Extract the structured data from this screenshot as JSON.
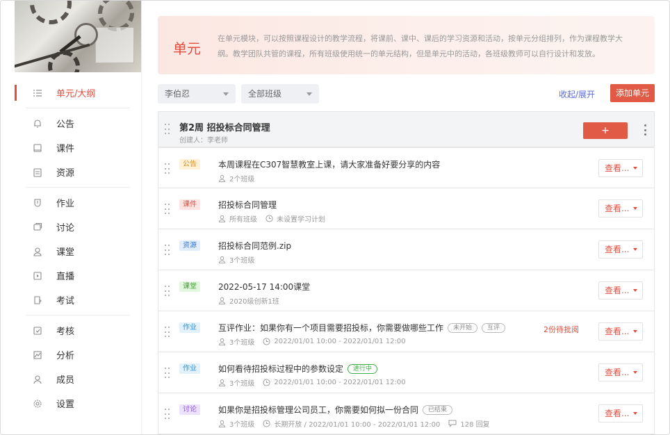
{
  "sidebar": {
    "items": [
      {
        "label": "单元/大纲",
        "icon": "list-icon",
        "active": true
      },
      {
        "label": "公告",
        "icon": "bell-icon"
      },
      {
        "label": "课件",
        "icon": "book-icon"
      },
      {
        "label": "资源",
        "icon": "folder-icon"
      },
      {
        "label": "作业",
        "icon": "shield-icon"
      },
      {
        "label": "讨论",
        "icon": "chat-icon"
      },
      {
        "label": "课堂",
        "icon": "user-icon"
      },
      {
        "label": "直播",
        "icon": "play-icon"
      },
      {
        "label": "考试",
        "icon": "exam-icon"
      },
      {
        "label": "考核",
        "icon": "check-square-icon"
      },
      {
        "label": "分析",
        "icon": "chart-icon"
      },
      {
        "label": "成员",
        "icon": "person-icon"
      },
      {
        "label": "设置",
        "icon": "gear-icon"
      }
    ]
  },
  "hero": {
    "title": "单元",
    "description": "在单元模块，可以按照课程设计的教学流程，将课前、课中、课后的学习资源和活动，按单元分组排列，作为课程教学大纲。教学团队共管的课程，所有班级使用统一的单元结构，但是单元中的活动，各班级教师可以自行设计和发放。"
  },
  "toolbar": {
    "teacher_select": "李伯忍",
    "class_select": "全部班级",
    "toggle_label": "收起/展开",
    "add_unit_label": "添加单元"
  },
  "week": {
    "title": "第2周 招投标合同管理",
    "creator": "创建人：李老师",
    "add_label": "+"
  },
  "items": [
    {
      "tag": "公告",
      "title": "本周课程在C307智慧教室上课，请大家准备好要分享的内容",
      "classes": "2个班级",
      "view": "查看..."
    },
    {
      "tag": "课件",
      "title": "招投标合同管理",
      "classes": "所有班级",
      "plan": "未设置学习计划",
      "view": "查看..."
    },
    {
      "tag": "资源",
      "title": "招投标合同范例.zip",
      "classes": "3个班级",
      "view": "查看..."
    },
    {
      "tag": "课堂",
      "title": "2022-05-17 14:00课堂",
      "classes": "2020级创新1班",
      "view": "查看..."
    },
    {
      "tag": "作业",
      "title": "互评作业：如果你有一个项目需要招投标，你需要做哪些工作",
      "pill1": "未开始",
      "pill2": "互评",
      "classes": "3个班级",
      "time": "2022/01/01 10:00 - 2022/01/01 12:00",
      "pending": "2份待批阅",
      "view": "查看..."
    },
    {
      "tag": "作业",
      "title": "如何看待招投标过程中的参数设定",
      "pill1": "进行中",
      "classes": "3个班级",
      "time": "2022/01/01 10:00 - 2022/01/01 12:00",
      "view": "查看..."
    },
    {
      "tag": "讨论",
      "title": "如果你是招投标管理公司员工，你需要如何拟一份合同",
      "pill1": "已结束",
      "classes": "3个班级",
      "time": "长期开放 / 2022/01/01 10:00 - 2022/01/01 12:00",
      "replies": "128 回复",
      "view": "查看..."
    }
  ]
}
